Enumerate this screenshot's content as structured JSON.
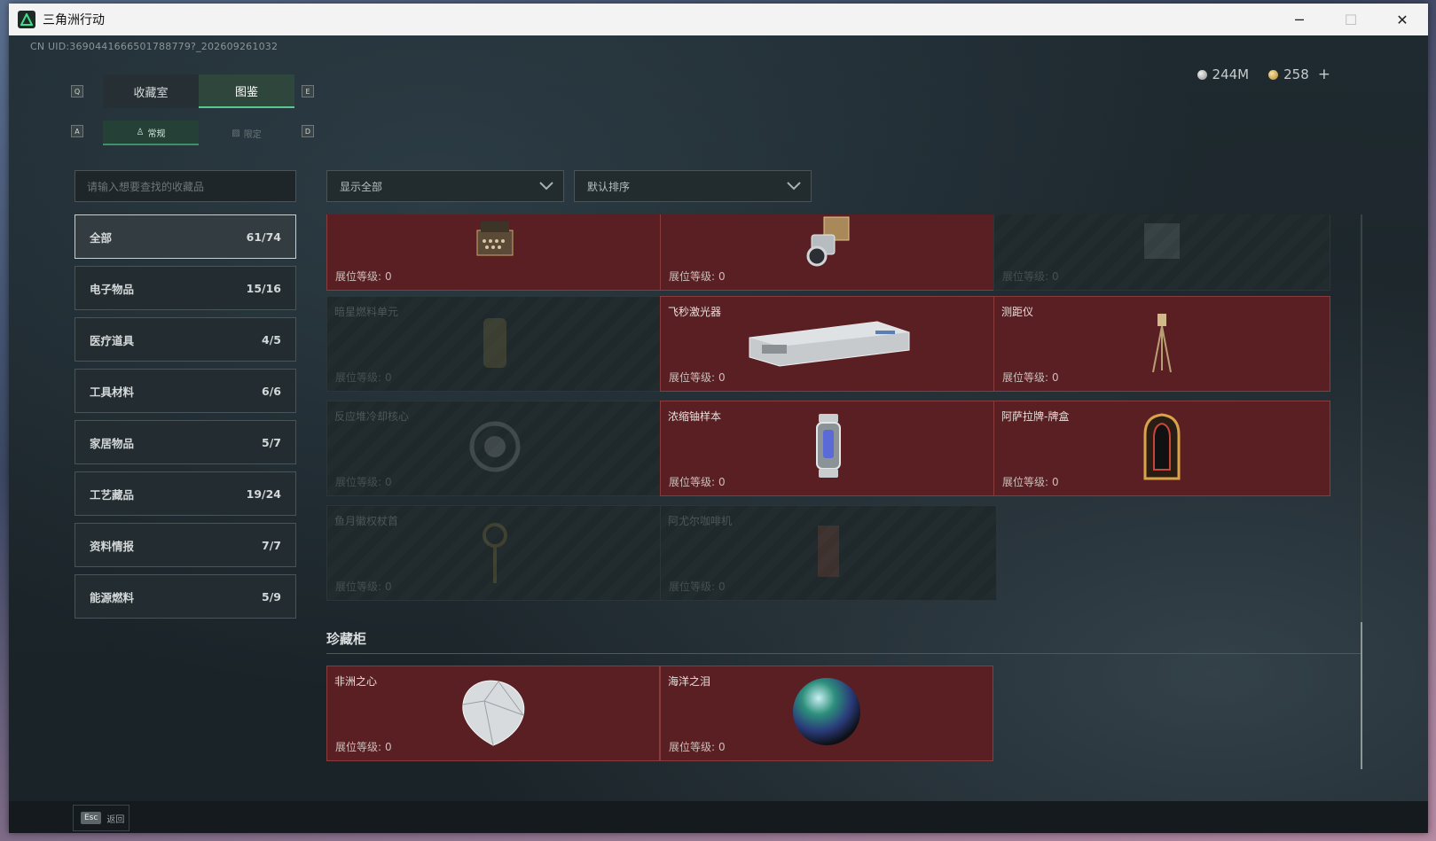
{
  "window": {
    "title": "三角洲行动",
    "controls": {
      "minimize": "─",
      "maximize": "☐",
      "close": "✕"
    }
  },
  "uid": "CN UID:3690441666501788779?_202609261032",
  "currency": {
    "silver": "244M",
    "gold": "258",
    "add": "+"
  },
  "tabs_main": {
    "key_left": "Q",
    "key_right": "E",
    "items": [
      {
        "label": "收藏室"
      },
      {
        "label": "图鉴"
      }
    ],
    "active": 1
  },
  "tabs_sub": {
    "key_left": "A",
    "key_right": "D",
    "items": [
      {
        "label": "常规"
      },
      {
        "label": "限定"
      }
    ],
    "active": 0
  },
  "search": {
    "placeholder": "请输入想要查找的收藏品"
  },
  "categories": [
    {
      "label": "全部",
      "count": "61/74"
    },
    {
      "label": "电子物品",
      "count": "15/16"
    },
    {
      "label": "医疗道具",
      "count": "4/5"
    },
    {
      "label": "工具材料",
      "count": "6/6"
    },
    {
      "label": "家居物品",
      "count": "5/7"
    },
    {
      "label": "工艺藏品",
      "count": "19/24"
    },
    {
      "label": "资料情报",
      "count": "7/7"
    },
    {
      "label": "能源燃料",
      "count": "5/9"
    }
  ],
  "filters": {
    "display": "显示全部",
    "sort": "默认排序"
  },
  "level_label": "展位等级:",
  "items": [
    {
      "name": "",
      "level": "0",
      "owned": true,
      "icon": "typewriter-icon"
    },
    {
      "name": "",
      "level": "0",
      "owned": true,
      "icon": "laser-emitter-icon"
    },
    {
      "name": "",
      "level": "0",
      "owned": false,
      "icon": "device-icon"
    },
    {
      "name": "暗星燃料单元",
      "level": "0",
      "owned": false,
      "icon": "fuel-cell-icon"
    },
    {
      "name": "飞秒激光器",
      "level": "0",
      "owned": true,
      "icon": "femtosecond-laser-icon"
    },
    {
      "name": "测距仪",
      "level": "0",
      "owned": true,
      "icon": "rangefinder-icon"
    },
    {
      "name": "反应堆冷却核心",
      "level": "0",
      "owned": false,
      "icon": "reactor-core-icon"
    },
    {
      "name": "浓缩铀样本",
      "level": "0",
      "owned": true,
      "icon": "uranium-sample-icon"
    },
    {
      "name": "阿萨拉牌-牌盒",
      "level": "0",
      "owned": true,
      "icon": "card-box-icon"
    },
    {
      "name": "鱼月徽权杖首",
      "level": "0",
      "owned": false,
      "icon": "scepter-head-icon"
    },
    {
      "name": "阿尤尔咖啡机",
      "level": "0",
      "owned": false,
      "icon": "coffee-machine-icon"
    }
  ],
  "section": {
    "title": "珍藏柜"
  },
  "treasures": [
    {
      "name": "非洲之心",
      "level": "0",
      "icon": "diamond-icon"
    },
    {
      "name": "海洋之泪",
      "level": "0",
      "icon": "pearl-icon"
    }
  ],
  "footer": {
    "esc_key": "Esc",
    "back_label": "返回"
  },
  "colors": {
    "accent": "#58c98f",
    "owned_card": "#5a1f22",
    "locked_card": "#1f282b"
  }
}
